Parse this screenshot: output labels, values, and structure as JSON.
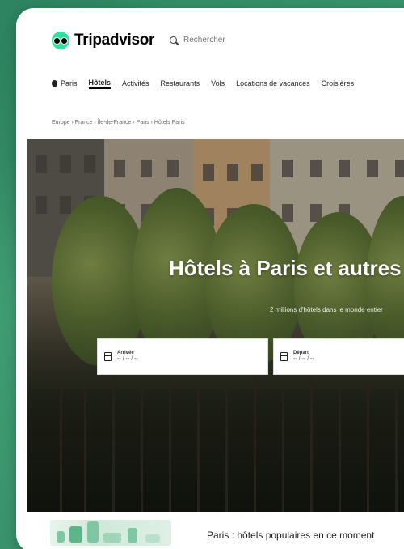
{
  "brand": {
    "name": "Tripadvisor",
    "accent_color": "#34e0a1"
  },
  "search": {
    "placeholder": "Rechercher",
    "icon": "search-icon"
  },
  "nav": {
    "items": [
      {
        "label": "Paris",
        "icon": "pin-icon",
        "active": false
      },
      {
        "label": "Hôtels",
        "active": true
      },
      {
        "label": "Activités",
        "active": false
      },
      {
        "label": "Restaurants",
        "active": false
      },
      {
        "label": "Vols",
        "active": false
      },
      {
        "label": "Locations de vacances",
        "active": false
      },
      {
        "label": "Croisières",
        "active": false
      }
    ]
  },
  "breadcrumb": "Europe › France › Île-de-France › Paris › Hôtels Paris",
  "hero": {
    "title": "Hôtels à Paris et autres",
    "subtitle": "2 millions d'hôtels dans le monde entier",
    "checkin": {
      "label": "Arrivée",
      "value": "-- / -- / --",
      "icon": "calendar-icon"
    },
    "checkout": {
      "label": "Départ",
      "value": "-- / -- / --",
      "icon": "calendar-icon"
    }
  },
  "bottom": {
    "title": "Paris : hôtels populaires en ce moment"
  }
}
